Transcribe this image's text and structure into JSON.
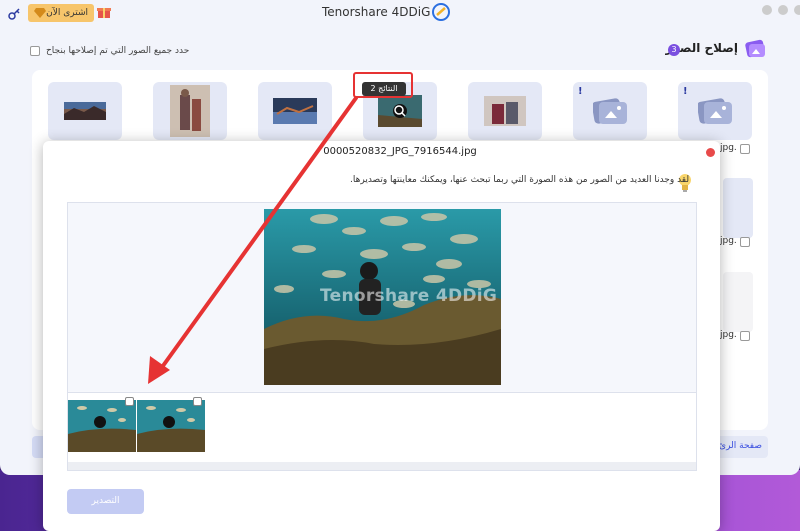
{
  "window": {
    "title": "Tenorshare 4DDiG"
  },
  "toolbar": {
    "buy_label": "اشترى الآن"
  },
  "section": {
    "title": "إصلاح الصور",
    "badge": "3"
  },
  "select_all": {
    "label": "حدد جميع الصور التي تم إصلاحها بنجاح"
  },
  "results_tag": {
    "label": "2 النتائج"
  },
  "side_labels": {
    "row1": "jpg.",
    "row2": "jpg.",
    "row3": "jpg."
  },
  "home_button": {
    "label": "صفحة الرئ"
  },
  "modal": {
    "filename": "0000520832_JPG_7916544.jpg",
    "message": "لقد وجدنا العديد من الصور من هذه الصورة التي ربما تبحث عنها، ويمكنك معاينتها وتصديرها.",
    "watermark": "Tenorshare 4DDiG",
    "export_label": "التصدير"
  },
  "colors": {
    "accent": "#3a4fe0",
    "highlight": "#e63333",
    "primary_light": "#c3cbf3"
  },
  "icons": [
    "key-icon",
    "gem-icon",
    "gift-icon",
    "logo-icon",
    "image-icon",
    "zoom-icon",
    "bulb-icon",
    "close-icon",
    "warning-icon"
  ]
}
